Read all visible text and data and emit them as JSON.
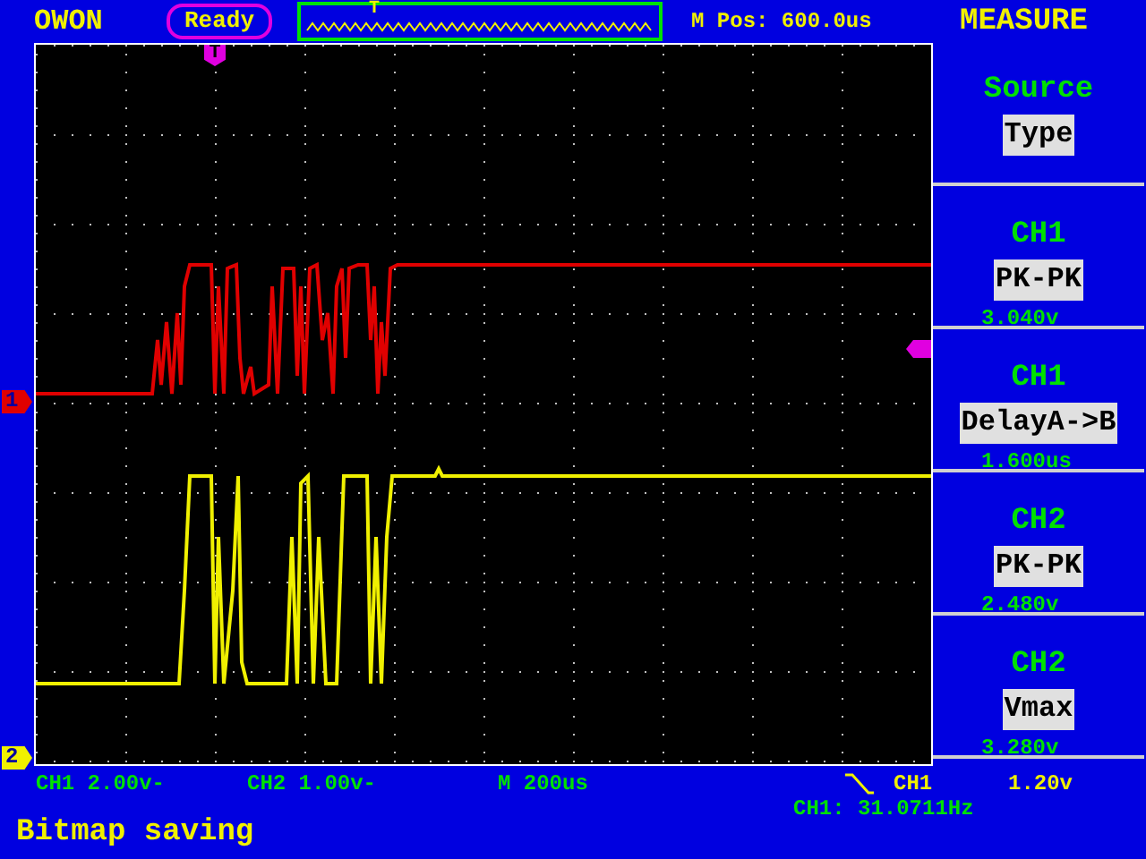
{
  "header": {
    "brand": "OWON",
    "status": "Ready",
    "trigger_mark": "T",
    "position": "M Pos: 600.0us",
    "menu_title": "MEASURE"
  },
  "markers": {
    "trigger_position": "T",
    "channel_1": "1",
    "channel_2": "2"
  },
  "measurements": [
    {
      "title": "Source",
      "value": "Type"
    },
    {
      "title": "CH1",
      "value": "PK-PK",
      "reading": "3.040v"
    },
    {
      "title": "CH1",
      "value": "DelayA->B",
      "reading": "1.600us"
    },
    {
      "title": "CH2",
      "value": "PK-PK",
      "reading": "2.480v"
    },
    {
      "title": "CH2",
      "value": "Vmax",
      "reading": "3.280v"
    }
  ],
  "footer": {
    "ch1_scale": "CH1 2.00v-",
    "ch2_scale": "CH2 1.00v-",
    "timebase": "M  200us",
    "trigger_source": "CH1",
    "trigger_level": "1.20v",
    "frequency": "CH1: 31.0711Hz",
    "message": "Bitmap saving"
  }
}
